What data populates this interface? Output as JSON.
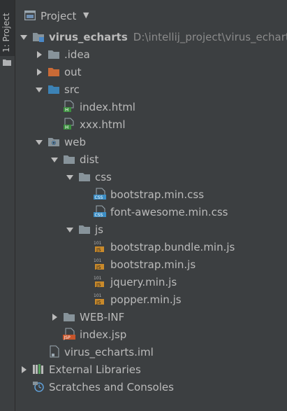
{
  "sidebar": {
    "tab_label": "1: Project"
  },
  "header": {
    "title": "Project",
    "caret_icon": "chevron-down-icon"
  },
  "tree": [
    {
      "label": "virus_echarts",
      "path": "D:\\intellij_project\\virus_echarts",
      "depth": 0,
      "expander": "expanded",
      "icon": "module-folder-icon",
      "bold": true
    },
    {
      "label": ".idea",
      "depth": 1,
      "expander": "collapsed",
      "icon": "folder-icon"
    },
    {
      "label": "out",
      "depth": 1,
      "expander": "collapsed",
      "icon": "excluded-folder-icon"
    },
    {
      "label": "src",
      "depth": 1,
      "expander": "expanded",
      "icon": "source-folder-icon"
    },
    {
      "label": "index.html",
      "depth": 2,
      "expander": "none",
      "icon": "html-file-icon"
    },
    {
      "label": "xxx.html",
      "depth": 2,
      "expander": "none",
      "icon": "html-file-icon"
    },
    {
      "label": "web",
      "depth": 1,
      "expander": "expanded",
      "icon": "web-folder-icon"
    },
    {
      "label": "dist",
      "depth": 2,
      "expander": "expanded",
      "icon": "folder-icon"
    },
    {
      "label": "css",
      "depth": 3,
      "expander": "expanded",
      "icon": "folder-icon"
    },
    {
      "label": "bootstrap.min.css",
      "depth": 4,
      "expander": "none",
      "icon": "css-file-icon"
    },
    {
      "label": "font-awesome.min.css",
      "depth": 4,
      "expander": "none",
      "icon": "css-file-icon"
    },
    {
      "label": "js",
      "depth": 3,
      "expander": "expanded",
      "icon": "folder-icon"
    },
    {
      "label": "bootstrap.bundle.min.js",
      "depth": 4,
      "expander": "none",
      "icon": "js-file-icon"
    },
    {
      "label": "bootstrap.min.js",
      "depth": 4,
      "expander": "none",
      "icon": "js-file-icon"
    },
    {
      "label": "jquery.min.js",
      "depth": 4,
      "expander": "none",
      "icon": "js-file-icon"
    },
    {
      "label": "popper.min.js",
      "depth": 4,
      "expander": "none",
      "icon": "js-file-icon"
    },
    {
      "label": "WEB-INF",
      "depth": 2,
      "expander": "collapsed",
      "icon": "folder-icon"
    },
    {
      "label": "index.jsp",
      "depth": 2,
      "expander": "none",
      "icon": "jsp-file-icon"
    },
    {
      "label": "virus_echarts.iml",
      "depth": 1,
      "expander": "none",
      "icon": "iml-file-icon"
    },
    {
      "label": "External Libraries",
      "depth": 0,
      "expander": "collapsed",
      "icon": "libraries-icon"
    },
    {
      "label": "Scratches and Consoles",
      "depth": 0,
      "expander": "none",
      "icon": "scratches-icon"
    }
  ]
}
